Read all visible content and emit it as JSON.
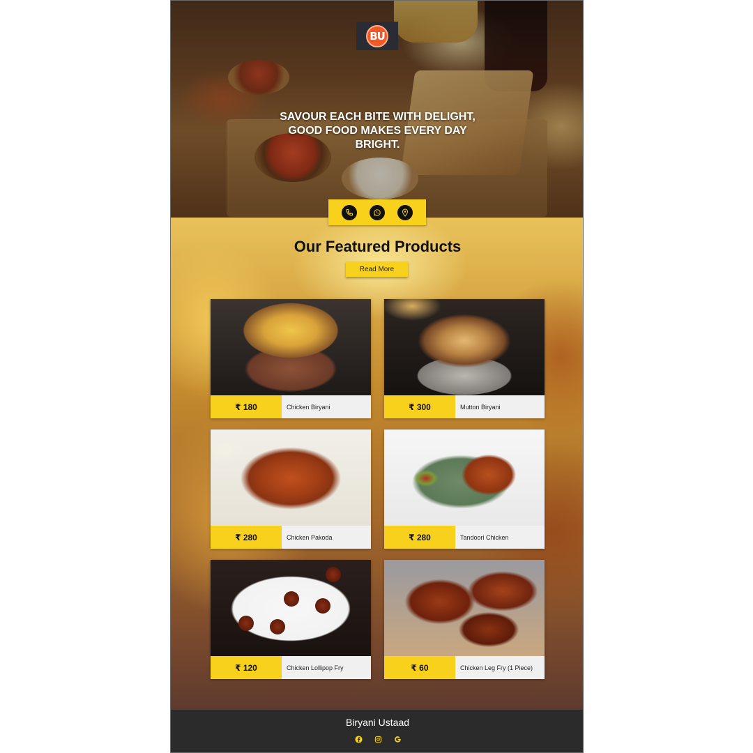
{
  "brand": {
    "logo_text": "BU",
    "tagline": "SAVOUR EACH BITE WITH DELIGHT, GOOD FOOD MAKES EVERY DAY BRIGHT.",
    "accent_color": "#f7d11c",
    "logo_color": "#f05a28"
  },
  "contact_icons": [
    "phone-icon",
    "whatsapp-icon",
    "location-pin-icon"
  ],
  "featured": {
    "title": "Our Featured Products",
    "read_more_label": "Read More",
    "products": [
      {
        "price": "₹ 180",
        "name": "Chicken Biryani",
        "image": "chicken-biryani-photo"
      },
      {
        "price": "₹ 300",
        "name": "Mutton Biryani",
        "image": "mutton-biryani-photo"
      },
      {
        "price": "₹ 280",
        "name": "Chicken Pakoda",
        "image": "chicken-pakoda-photo"
      },
      {
        "price": "₹ 280",
        "name": "Tandoori Chicken",
        "image": "tandoori-chicken-photo"
      },
      {
        "price": "₹ 120",
        "name": "Chicken Lollipop Fry",
        "image": "chicken-lollipop-photo"
      },
      {
        "price": "₹ 60",
        "name": "Chicken Leg Fry (1 Piece)",
        "image": "chicken-leg-fry-photo"
      }
    ]
  },
  "footer": {
    "title": "Biryani Ustaad",
    "social_icons": [
      "facebook-icon",
      "instagram-icon",
      "google-icon"
    ]
  }
}
